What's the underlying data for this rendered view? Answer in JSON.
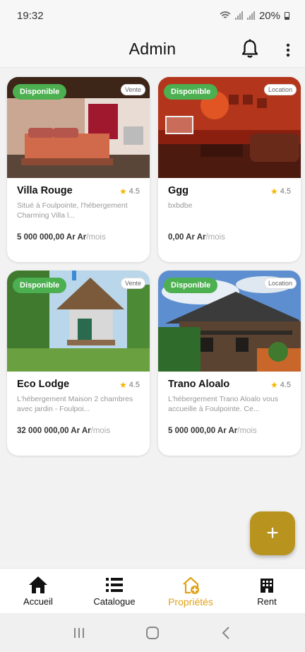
{
  "status_bar": {
    "time": "19:32",
    "battery": "20%"
  },
  "header": {
    "title": "Admin"
  },
  "properties": [
    {
      "status": "Disponible",
      "type": "Vente",
      "title": "Villa Rouge",
      "rating": "4.5",
      "description": "Situé à Foulpointe, l'hébergement Charming Villa l...",
      "price": "5 000 000,00 Ar Ar",
      "period": "/mois"
    },
    {
      "status": "Disponible",
      "type": "Location",
      "title": "Ggg",
      "rating": "4.5",
      "description": "bxbdbe",
      "price": "0,00 Ar Ar",
      "period": "/mois"
    },
    {
      "status": "Disponible",
      "type": "Vente",
      "title": "Eco Lodge",
      "rating": "4.5",
      "description": "L'hébergement Maison 2 chambres avec jardin - Foulpoi...",
      "price": "32 000 000,00 Ar Ar",
      "period": "/mois"
    },
    {
      "status": "Disponible",
      "type": "Location",
      "title": "Trano Aloalo",
      "rating": "4.5",
      "description": "L'hébergement Trano Aloalo vous accueille à Foulpointe. Ce...",
      "price": "5 000 000,00 Ar Ar",
      "period": "/mois"
    }
  ],
  "fab": {
    "label": "+"
  },
  "bottom_nav": [
    {
      "label": "Accueil",
      "icon": "home-icon"
    },
    {
      "label": "Catalogue",
      "icon": "list-icon"
    },
    {
      "label": "Propriétés",
      "icon": "house-add-icon",
      "active": true
    },
    {
      "label": "Rent",
      "icon": "building-icon"
    }
  ],
  "colors": {
    "accent": "#b8941f",
    "active_nav": "#e0a21a",
    "available_badge": "#4caf50",
    "star": "#f4b400"
  }
}
